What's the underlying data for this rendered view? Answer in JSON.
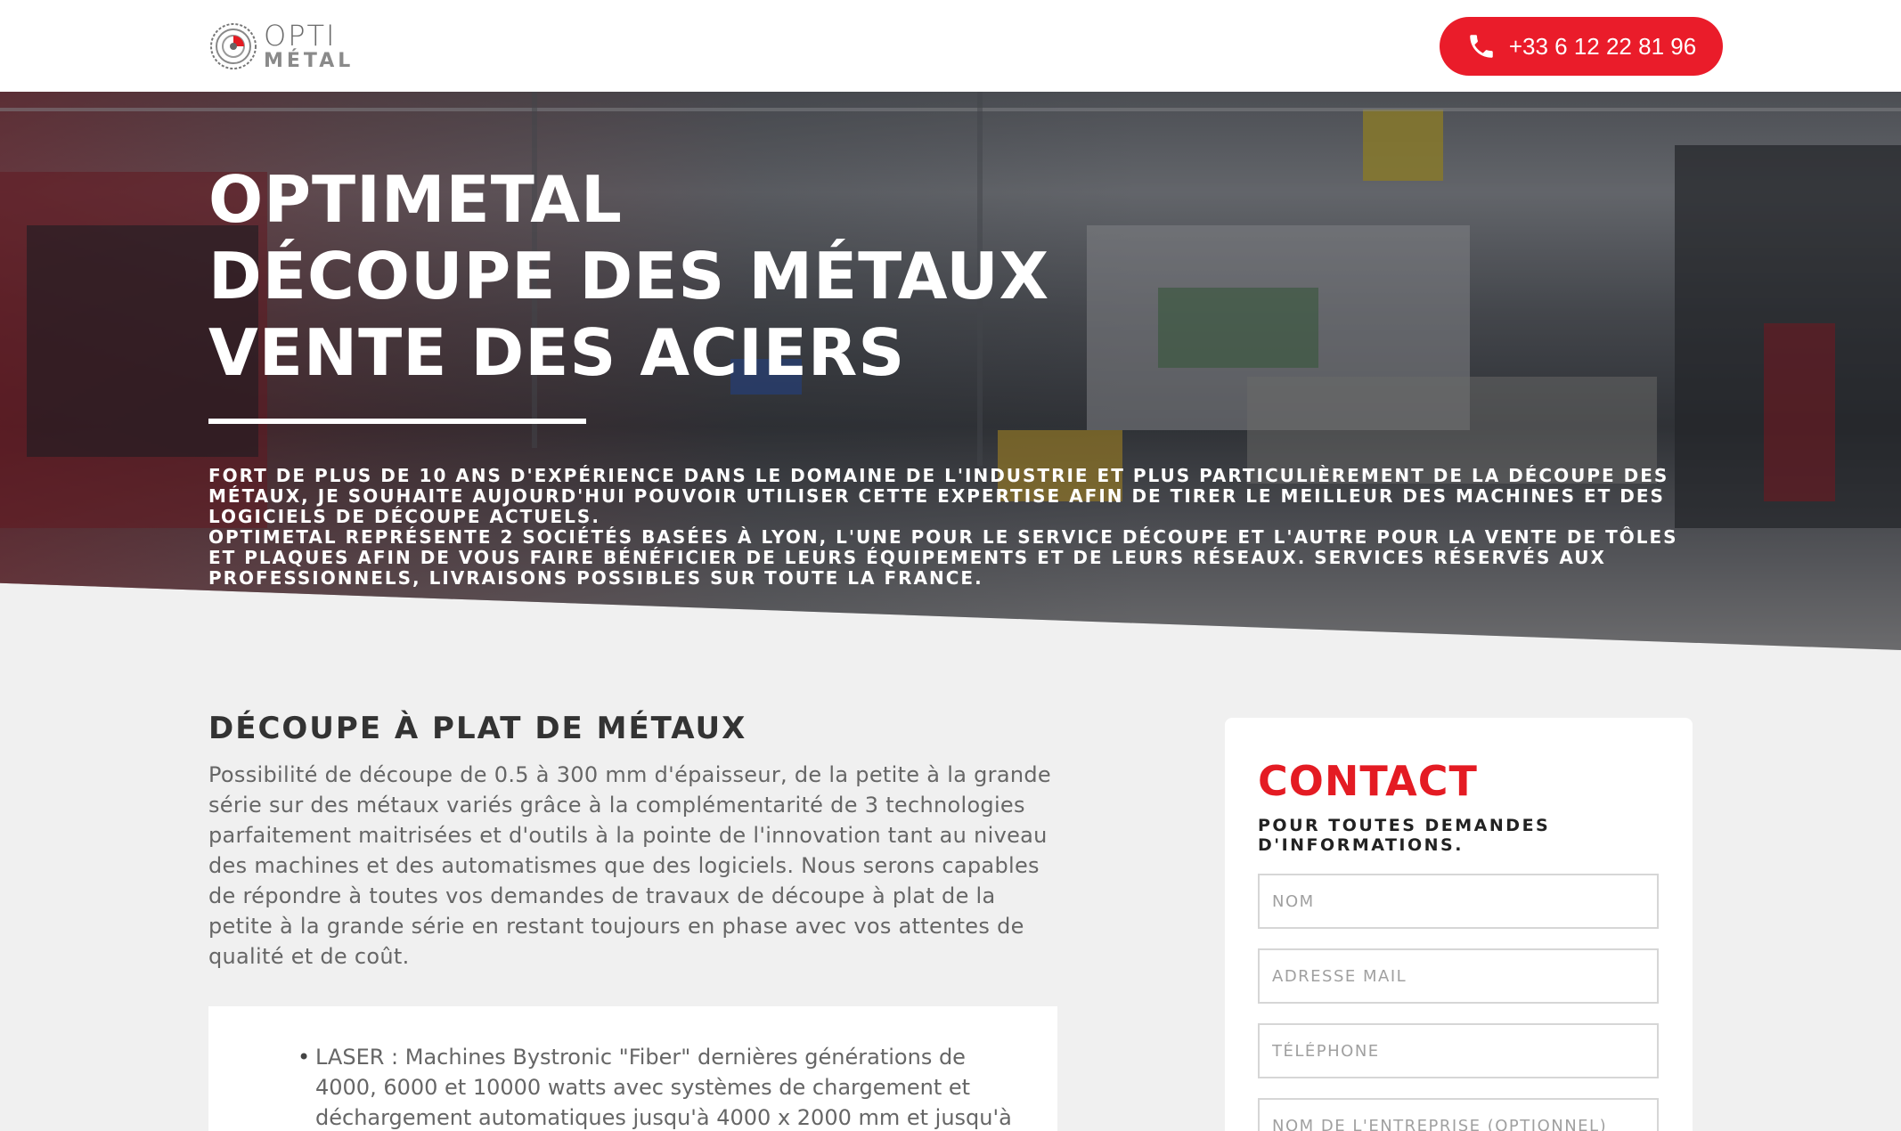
{
  "header": {
    "logo_top": "OPTI",
    "logo_bottom": "MÉTAL",
    "phone": "+33 6 12 22 81 96",
    "phone_icon": "phone-icon",
    "accent_color": "#ea1c2a"
  },
  "hero": {
    "title_lines": [
      "OPTIMETAL",
      "DÉCOUPE DES MÉTAUX",
      "VENTE DES ACIERS"
    ],
    "paragraph_1": "FORT DE PLUS DE 10 ANS D'EXPÉRIENCE DANS LE DOMAINE DE L'INDUSTRIE ET PLUS PARTICULIÈREMENT DE LA DÉCOUPE DES MÉTAUX, JE SOUHAITE AUJOURD'HUI POUVOIR UTILISER CETTE EXPERTISE AFIN DE TIRER LE MEILLEUR DES MACHINES ET DES LOGICIELS DE DÉCOUPE ACTUELS.",
    "paragraph_2": "OPTIMETAL REPRÉSENTE 2 SOCIÉTÉS BASÉES À LYON, L'UNE POUR LE SERVICE DÉCOUPE ET L'AUTRE POUR LA VENTE DE TÔLES ET PLAQUES AFIN DE VOUS FAIRE BÉNÉFICIER DE LEURS ÉQUIPEMENTS ET DE LEURS RÉSEAUX. SERVICES RÉSERVÉS AUX PROFESSIONNELS, LIVRAISONS POSSIBLES SUR TOUTE LA FRANCE."
  },
  "main": {
    "section_title": "DÉCOUPE À PLAT DE MÉTAUX",
    "section_body": "Possibilité de découpe de 0.5 à 300 mm d'épaisseur, de la petite à la grande série sur des métaux variés grâce à la complémentarité de 3 technologies parfaitement maitrisées et d'outils à la pointe de l'innovation tant au niveau des machines et des automatismes que des logiciels. Nous serons capables de répondre à toutes vos demandes de travaux de découpe à plat de la petite à la grande série en restant toujours en phase avec vos attentes de qualité et de coût.",
    "list_items": [
      "LASER : Machines Bystronic \"Fiber\" dernières générations de 4000, 6000 et 10000 watts avec systèmes de chargement et déchargement automatiques jusqu'à 4000 x 2000 mm et jusqu'à"
    ]
  },
  "contact": {
    "title": "CONTACT",
    "subtitle": "POUR TOUTES DEMANDES D'INFORMATIONS.",
    "fields": {
      "name": "NOM",
      "email": "ADRESSE MAIL",
      "phone": "TÉLÉPHONE",
      "company": "NOM DE L'ENTREPRISE (OPTIONNEL)"
    },
    "title_color": "#e41b23"
  }
}
